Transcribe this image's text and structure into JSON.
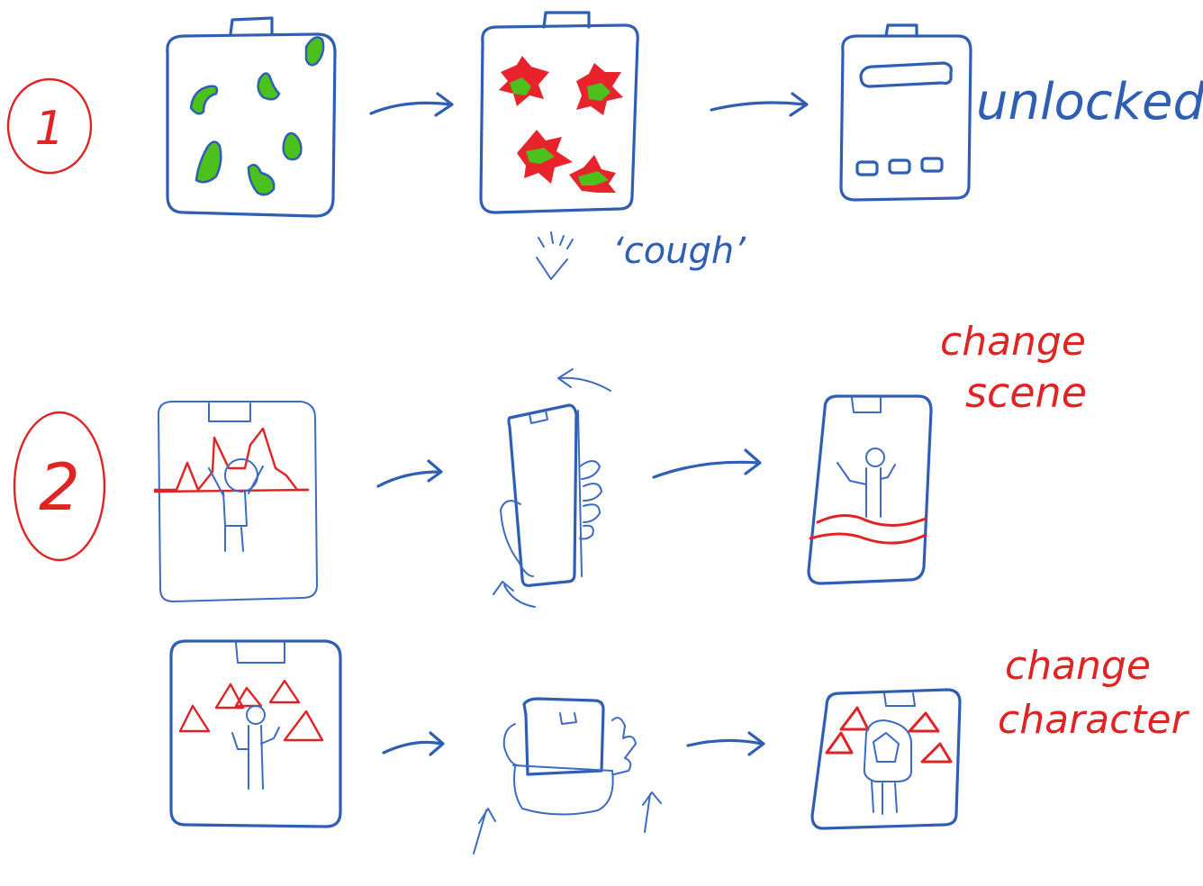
{
  "row1": {
    "number": "1",
    "unlocked_label": "unlocked!",
    "cough_label": "‘cough’"
  },
  "row2": {
    "number": "2",
    "caption_line1": "change",
    "caption_line2": "scene"
  },
  "row3": {
    "caption_line1": "change",
    "caption_line2": "character"
  },
  "colors": {
    "ink_blue": "#2f5fb3",
    "ink_red": "#e02424",
    "germ_green": "#4cc11e"
  }
}
